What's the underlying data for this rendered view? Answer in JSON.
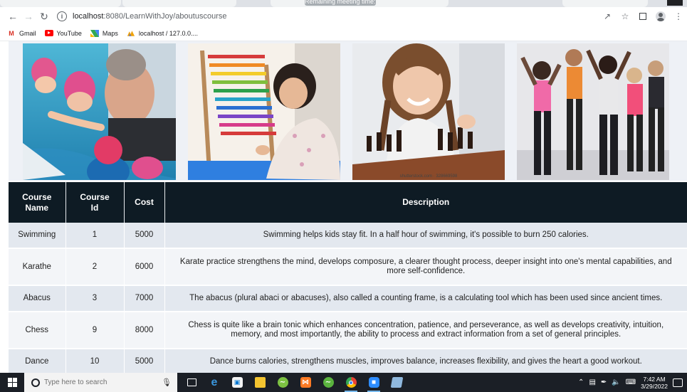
{
  "browser": {
    "tab_banner": "Remaining meeting time: 0:00",
    "url_host": "localhost",
    "url_path": ":8080/LearnWithJoy/aboutuscourse",
    "bookmarks": [
      {
        "label": "Gmail",
        "icon": "gmail-icon"
      },
      {
        "label": "YouTube",
        "icon": "youtube-icon"
      },
      {
        "label": "Maps",
        "icon": "maps-icon"
      },
      {
        "label": "localhost / 127.0.0....",
        "icon": "phpmyadmin-icon"
      }
    ]
  },
  "gallery": {
    "photos": [
      {
        "name": "swimming-photo",
        "watermark": ""
      },
      {
        "name": "abacus-photo",
        "watermark": ""
      },
      {
        "name": "chess-photo",
        "watermark": "shutterstock.com · 328669598"
      },
      {
        "name": "dance-photo",
        "watermark": ""
      }
    ]
  },
  "table": {
    "headers": {
      "name_line1": "Course",
      "name_line2": "Name",
      "id_line1": "Course",
      "id_line2": "Id",
      "cost": "Cost",
      "description": "Description"
    },
    "rows": [
      {
        "name": "Swimming",
        "id": "1",
        "cost": "5000",
        "description": "Swimming helps kids stay fit. In a half hour of swimming, it's possible to burn 250 calories."
      },
      {
        "name": "Karathe",
        "id": "2",
        "cost": "6000",
        "description": "Karate practice strengthens the mind, develops composure, a clearer thought process, deeper insight into one's mental capabilities, and more self-confidence."
      },
      {
        "name": "Abacus",
        "id": "3",
        "cost": "7000",
        "description": "The abacus (plural abaci or abacuses), also called a counting frame, is a calculating tool which has been used since ancient times."
      },
      {
        "name": "Chess",
        "id": "9",
        "cost": "8000",
        "description": "Chess is quite like a brain tonic which enhances concentration, patience, and perseverance, as well as develops creativity, intuition, memory, and most importantly, the ability to process and extract information from a set of general principles."
      },
      {
        "name": "Dance",
        "id": "10",
        "cost": "5000",
        "description": "Dance burns calories, strengthens muscles, improves balance, increases flexibility, and gives the heart a good workout."
      }
    ]
  },
  "taskbar": {
    "search_placeholder": "Type here to search",
    "time": "7:42 AM",
    "date": "3/29/2022"
  },
  "colors": {
    "table_header_bg": "#0e1b24",
    "row_odd_bg": "#e3e8ef",
    "row_even_bg": "#f3f5f8",
    "taskbar_bg": "#1b1f26"
  }
}
